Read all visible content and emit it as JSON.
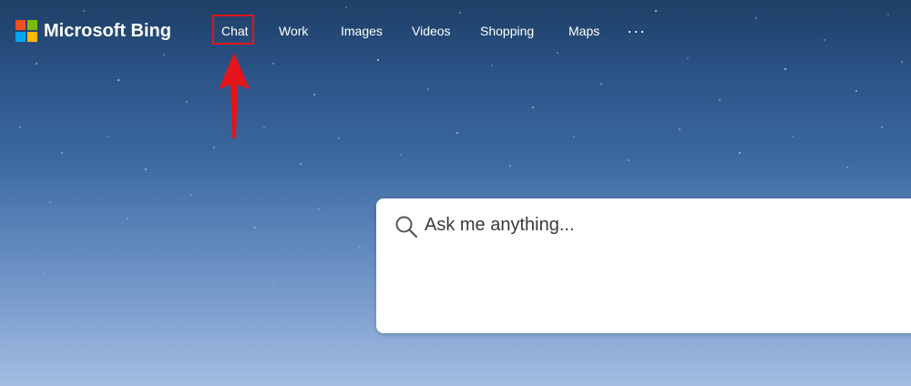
{
  "brand": {
    "name": "Microsoft Bing",
    "logo_colors": [
      "#f25022",
      "#7fba00",
      "#00a4ef",
      "#ffb900"
    ]
  },
  "nav": {
    "items": [
      {
        "label": "Chat"
      },
      {
        "label": "Work"
      },
      {
        "label": "Images"
      },
      {
        "label": "Videos"
      },
      {
        "label": "Shopping"
      },
      {
        "label": "Maps"
      }
    ],
    "more_label": "···",
    "more_icon": "ellipsis-icon"
  },
  "annotation": {
    "highlight_color": "#e3151a",
    "arrow_icon": "arrow-up-icon"
  },
  "search": {
    "placeholder": "Ask me anything...",
    "value": "",
    "icon": "search-icon"
  }
}
